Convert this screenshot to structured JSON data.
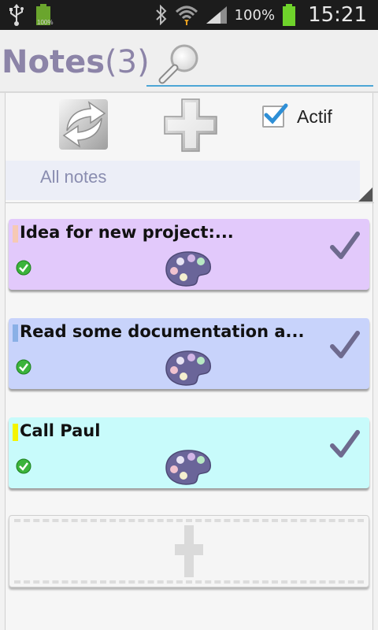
{
  "status_bar": {
    "battery_small_label": "100%",
    "battery_pct": "100%",
    "time": "15:21"
  },
  "header": {
    "title": "Notes",
    "count": "(3)",
    "search": {
      "value": "",
      "placeholder": ""
    }
  },
  "toolbar": {
    "actif_label": "Actif",
    "actif_checked": true,
    "filter_label": "All notes"
  },
  "notes": [
    {
      "title": "Idea for new project:...",
      "color": "#e2c9fb",
      "tag_color": "#f6c9b4",
      "status": "done"
    },
    {
      "title": "Read some documentation a...",
      "color": "#c8d3fb",
      "tag_color": "#8ab0e6",
      "status": "done"
    },
    {
      "title": "Call Paul",
      "color": "#c8fbfb",
      "tag_color": "#f4f400",
      "status": "done"
    }
  ],
  "icons": {
    "status": "green-check-circle-icon",
    "palette": "palette-icon",
    "done": "checkmark-icon",
    "refresh": "refresh-icon",
    "add": "add-icon",
    "search": "search-icon"
  },
  "colors": {
    "accent": "#4da6d6",
    "title": "#8c84a8",
    "check": "#6e6a8e"
  }
}
